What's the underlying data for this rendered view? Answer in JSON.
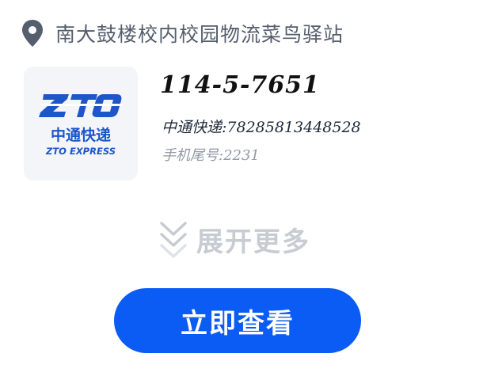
{
  "location": {
    "text": "南大鼓楼校内校园物流菜鸟驿站",
    "icon": "location-pin-icon"
  },
  "parcel": {
    "pickup_code": "114-5-7651",
    "courier_line": "中通快递:78285813448528",
    "phone_line": "手机尾号:2231"
  },
  "logo": {
    "mark": "ZTO",
    "name_cn": "中通快递",
    "name_en": "ZTO EXPRESS",
    "color": "#1e56c9"
  },
  "expand": {
    "label": "展开更多",
    "icon": "double-chevron-down-icon"
  },
  "action": {
    "view_label": "立即查看",
    "color": "#0b5cf5"
  }
}
